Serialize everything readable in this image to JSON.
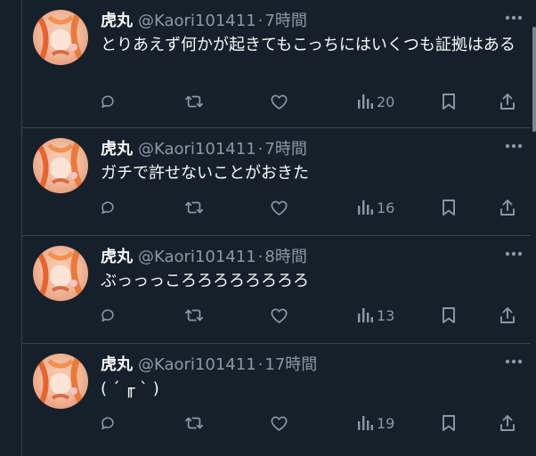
{
  "colors": {
    "background": "#15202b",
    "divider": "#38444d",
    "text_primary": "#f7f9f9",
    "text_secondary": "#8b98a5"
  },
  "tweets": [
    {
      "name": "虎丸",
      "handle": "@Kaori101411",
      "separator": "·",
      "time": "7時間",
      "text": "とりあえず何かが起きてもこっちにはいくつも証拠はある",
      "views": "20"
    },
    {
      "name": "虎丸",
      "handle": "@Kaori101411",
      "separator": "·",
      "time": "7時間",
      "text": "ガチで許せないことがおきた",
      "views": "16"
    },
    {
      "name": "虎丸",
      "handle": "@Kaori101411",
      "separator": "·",
      "time": "8時間",
      "text": "ぶっっっころろろろろろろろ",
      "views": "13"
    },
    {
      "name": "虎丸",
      "handle": "@Kaori101411",
      "separator": "·",
      "time": "17時間",
      "text": "( ´ ╓ ` )",
      "views": "19"
    }
  ],
  "icons": {
    "reply": "reply-icon",
    "retweet": "retweet-icon",
    "like": "heart-icon",
    "views": "views-chart-icon",
    "bookmark": "bookmark-icon",
    "share": "share-icon",
    "more": "more-options-icon"
  }
}
